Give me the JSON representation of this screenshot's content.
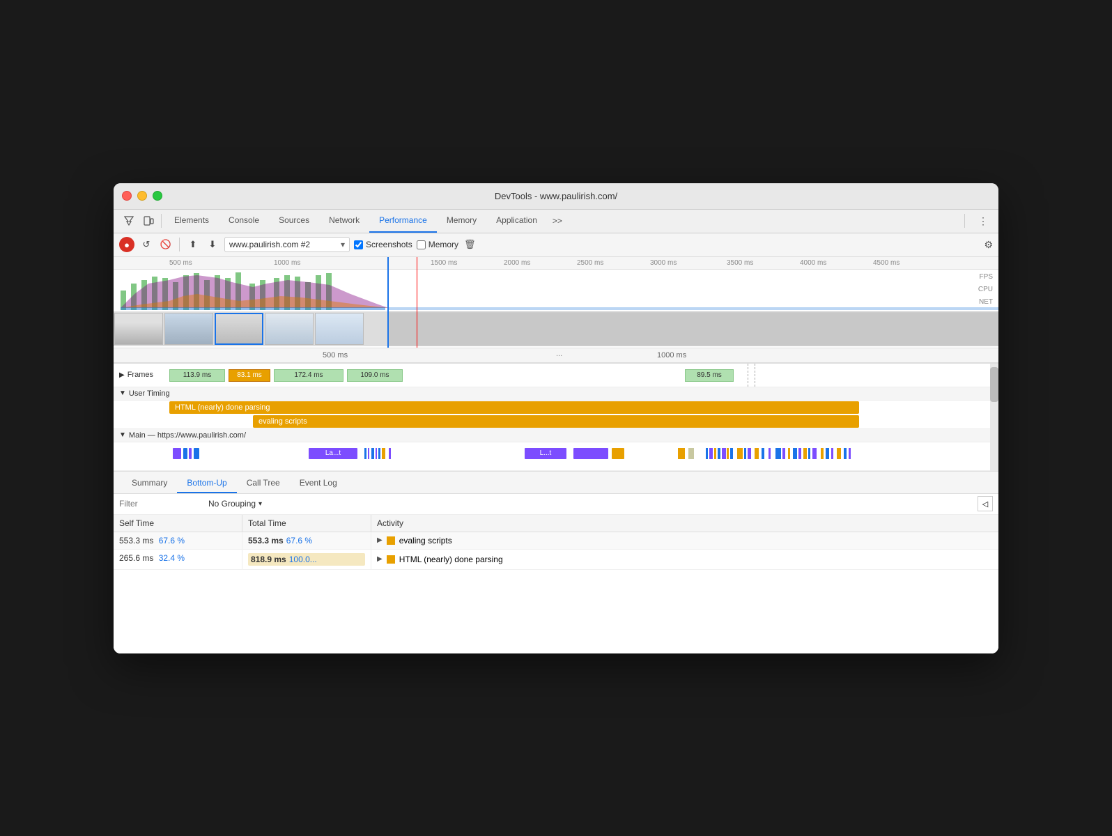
{
  "window": {
    "title": "DevTools - www.paulirish.com/"
  },
  "tabs": {
    "items": [
      {
        "label": "Elements",
        "active": false
      },
      {
        "label": "Console",
        "active": false
      },
      {
        "label": "Sources",
        "active": false
      },
      {
        "label": "Network",
        "active": false
      },
      {
        "label": "Performance",
        "active": true
      },
      {
        "label": "Memory",
        "active": false
      },
      {
        "label": "Application",
        "active": false
      }
    ],
    "overflow": ">>",
    "more_icon": "⋮"
  },
  "toolbar": {
    "record_tooltip": "Record",
    "reload_tooltip": "Reload",
    "clear_tooltip": "Clear",
    "upload_tooltip": "Upload",
    "download_tooltip": "Download",
    "url_value": "www.paulirish.com #2",
    "screenshots_label": "Screenshots",
    "memory_label": "Memory",
    "screenshots_checked": true,
    "memory_checked": false,
    "gear_tooltip": "Settings"
  },
  "timeline": {
    "ruler_labels": [
      "500 ms",
      "1000 ms",
      "1500 ms",
      "2000 ms",
      "2500 ms",
      "3000 ms",
      "3500 ms",
      "4000 ms",
      "4500 ms"
    ],
    "side_labels": [
      "FPS",
      "CPU",
      "NET"
    ],
    "bottom_ruler": [
      "500 ms",
      "1000 ms"
    ],
    "frames": [
      {
        "label": "113.9 ms",
        "selected": false
      },
      {
        "label": "83.1 ms",
        "selected": true
      },
      {
        "label": "172.4 ms",
        "selected": false
      },
      {
        "label": "109.0 ms",
        "selected": false
      },
      {
        "label": "89.5 ms",
        "selected": false
      }
    ],
    "frames_track_label": "Frames",
    "user_timing_label": "User Timing",
    "user_timing_bars": [
      {
        "label": "HTML (nearly) done parsing",
        "color": "#e8a000"
      },
      {
        "label": "evaling scripts",
        "color": "#e8a000"
      }
    ],
    "main_label": "Main — https://www.paulirish.com/",
    "dotdotdot": "..."
  },
  "analysis": {
    "tabs": [
      "Summary",
      "Bottom-Up",
      "Call Tree",
      "Event Log"
    ],
    "active_tab": "Bottom-Up",
    "filter_placeholder": "Filter",
    "grouping_label": "No Grouping",
    "columns": {
      "self_time": "Self Time",
      "total_time": "Total Time",
      "activity": "Activity"
    },
    "rows": [
      {
        "self_time": "553.3 ms",
        "self_percent": "67.6 %",
        "total_time": "553.3 ms",
        "total_percent": "67.6 %",
        "total_bar_width": 67,
        "activity_label": "evaling scripts",
        "activity_color": "#e8a000"
      },
      {
        "self_time": "265.6 ms",
        "self_percent": "32.4 %",
        "total_time": "818.9 ms",
        "total_percent": "100.0...",
        "total_bar_width": 100,
        "activity_label": "HTML (nearly) done parsing",
        "activity_color": "#e8a000"
      }
    ]
  }
}
